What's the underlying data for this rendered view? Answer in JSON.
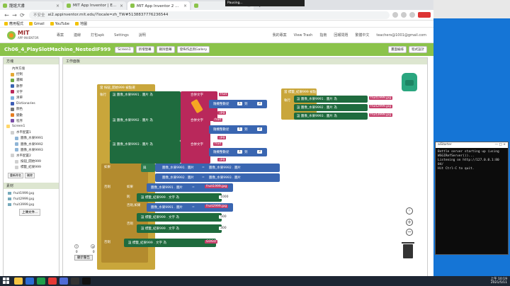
{
  "browser": {
    "tabs": [
      {
        "label": "龍誼犬書",
        "active": false
      },
      {
        "label": "MIT App Inventor | Explore MIT",
        "active": false
      },
      {
        "label": "MIT App Inventor 2 電腦版",
        "active": true
      },
      {
        "label": "",
        "active": false
      }
    ],
    "url": "ai2.appinventor.mit.edu/?locale=zh_TW#5138837776236544",
    "security_label": "不安全",
    "bookmarks": [
      "應用程式",
      "Gmail",
      "YouTube",
      "地圖"
    ]
  },
  "screen_recorder": "Pausing...",
  "ai_header": {
    "logo_title": "MIT",
    "logo_subtitle": "APP INVENTOR",
    "menus": [
      "專案",
      "連線",
      "打包apk",
      "Settings",
      "說明"
    ],
    "right_links": [
      "我的專案",
      "View Trash",
      "指南",
      "回報問題",
      "繁體中文",
      "teachers@1001@gmail.com"
    ]
  },
  "project_bar": {
    "project_name": "Ch06_4_PlaySlotMachine_NestedIF999",
    "screen_select": "Screen1",
    "add_screen": "新增螢幕",
    "remove_screen": "刪除螢幕",
    "publish": "發佈作品到Gallery",
    "designer": "畫面編排",
    "blocks": "程式設計"
  },
  "left_panel": {
    "title": "方塊",
    "tree": [
      {
        "label": "內件方塊",
        "level": 0,
        "color": "#ffffff"
      },
      {
        "label": "控制",
        "level": 1,
        "color": "#e4a835"
      },
      {
        "label": "邏輯",
        "level": 1,
        "color": "#6fa843"
      },
      {
        "label": "數學",
        "level": 1,
        "color": "#3a66b1"
      },
      {
        "label": "文字",
        "level": 1,
        "color": "#b9285b"
      },
      {
        "label": "清單",
        "level": 1,
        "color": "#7fb0e0"
      },
      {
        "label": "Dictionaries",
        "level": 1,
        "color": "#3d5db5"
      },
      {
        "label": "顏色",
        "level": 1,
        "color": "#777777"
      },
      {
        "label": "變數",
        "level": 1,
        "color": "#e67e22"
      },
      {
        "label": "程序",
        "level": 1,
        "color": "#7b4ea8"
      },
      {
        "label": "Screen1",
        "level": 0,
        "color": "#ffd76a"
      },
      {
        "label": "水平配置1",
        "level": 1,
        "color": "#cfcfcf"
      },
      {
        "label": "圖像_水果9991",
        "level": 2,
        "color": "#8fb5d6"
      },
      {
        "label": "圖像_水果9992",
        "level": 2,
        "color": "#8fb5d6"
      },
      {
        "label": "圖像_水果9993",
        "level": 2,
        "color": "#8fb5d6"
      },
      {
        "label": "水平配置2",
        "level": 1,
        "color": "#cfcfcf"
      },
      {
        "label": "按鈕_開始999",
        "level": 2,
        "color": "#cfcfcf"
      },
      {
        "label": "標籤_結果999",
        "level": 2,
        "color": "#cfcfcf"
      }
    ],
    "tree_buttons": [
      "重新命名",
      "刪除"
    ],
    "media_title": "素材",
    "media": [
      "fruit1999.jpg",
      "fruit2999.jpg",
      "fruit3999.jpg"
    ],
    "upload_button": "上傳文件..."
  },
  "workspace": {
    "title": "工作面板",
    "warnings": {
      "warn_count": "0",
      "error_count": "0",
      "toggle": "顯示警告"
    },
    "blocks": {
      "event1": "當 按鈕_開始999 被點選",
      "do": "執行",
      "set1": "設 圖像_水果9991 . 圖片 為",
      "set2": "設 圖像_水果9992 . 圖片 為",
      "set3": "設 圖像_水果9993 . 圖片 為",
      "join": "合併文字",
      "fruit": "fruit",
      "random": "隨機整數從",
      "n1": "1",
      "to": "到",
      "n3": "3",
      "ext": ".jpg",
      "if": "如果",
      "then": "則",
      "else": "否則",
      "elseif": "否則,如果",
      "cmp1": "圖像_水果9991 . 圖片",
      "cmp2": "圖像_水果9992 . 圖片",
      "cmp3": "圖像_水果9993 . 圖片",
      "eq": "=",
      "and": "與",
      "set_label": "設 標籤_結果999 . 文字 為",
      "fruit1": "fruit1999.jpg",
      "fruit2": "fruit2999.jpg",
      "fruit3": "fruit3999.jpg",
      "v1000": "1000",
      "v500": "500",
      "v300": "300",
      "gogo": "GOGO",
      "event2": "當 標籤_結果999 被點選",
      "r1": "設 圖像_水果9991 . 圖片 為",
      "r2": "設 圖像_水果9992 . 圖片 為",
      "r3": "設 圖像_水果9993 . 圖片 為"
    }
  },
  "console": {
    "title": "aiStarter",
    "lines": [
      "Bottle server starting up (using",
      "WSGIRefServer())...",
      "Listening on http://127.0.0.1:80",
      "04/",
      "Hit Ctrl-C to quit."
    ]
  },
  "taskbar": {
    "time": "上午 10:19",
    "date": "2021/5/11"
  }
}
